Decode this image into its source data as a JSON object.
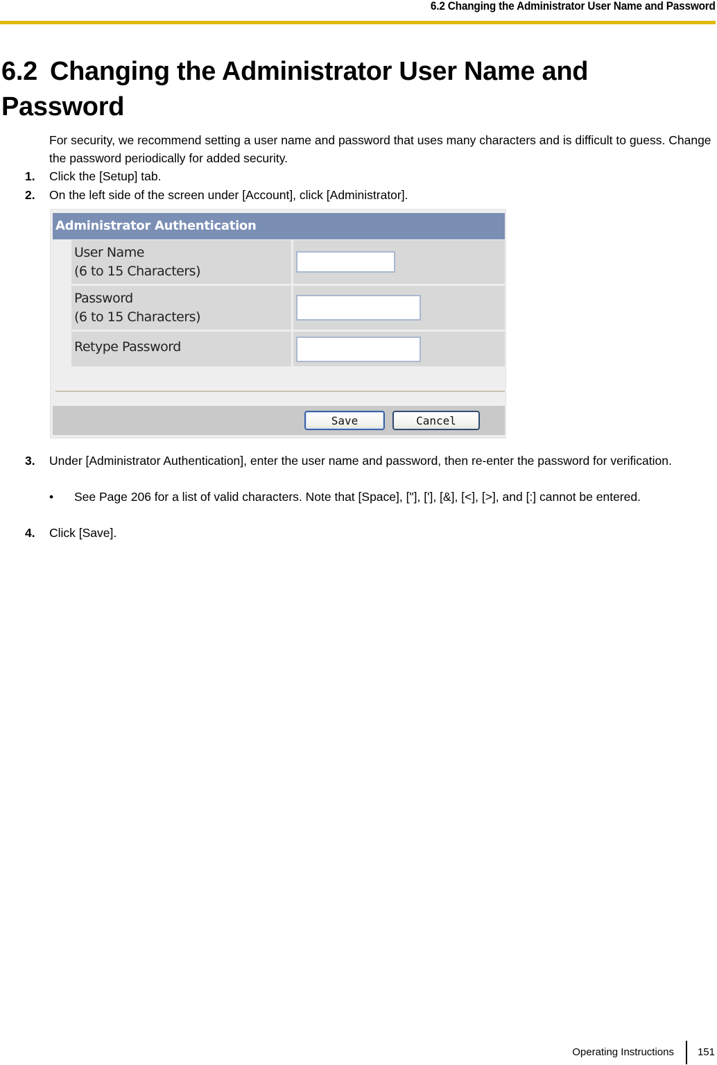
{
  "running_header": "6.2 Changing the Administrator User Name and Password",
  "section": {
    "number": "6.2",
    "title": "Changing the Administrator User Name and Password"
  },
  "intro": "For security, we recommend setting a user name and password that uses many characters and is difficult to guess. Change the password periodically for added security.",
  "steps": [
    {
      "num": "1.",
      "text": "Click the [Setup] tab."
    },
    {
      "num": "2.",
      "text": "On the left side of the screen under [Account], click [Administrator]."
    },
    {
      "num": "3.",
      "text": "Under [Administrator Authentication], enter the user name and password, then re-enter the password for verification."
    },
    {
      "num": "4.",
      "text": "Click [Save]."
    }
  ],
  "step3_bullet": {
    "marker": "•",
    "text": "See Page 206 for a list of valid characters. Note that [Space], [\"], ['], [&], [<], [>], and [:] cannot be entered."
  },
  "screenshot": {
    "header": "Administrator Authentication",
    "fields": [
      {
        "label_line1": "User Name",
        "label_line2": "(6 to 15 Characters)",
        "value": ""
      },
      {
        "label_line1": "Password",
        "label_line2": "(6 to 15 Characters)",
        "value": ""
      },
      {
        "label_line1": "Retype Password",
        "label_line2": "",
        "value": ""
      }
    ],
    "save_label": "Save",
    "cancel_label": "Cancel",
    "colors": {
      "header_bg": "#7b8fb5",
      "row_bg": "#d8d8d8"
    }
  },
  "footer": {
    "label": "Operating Instructions",
    "page": "151"
  },
  "colors": {
    "header_rule": "#e0b800"
  }
}
